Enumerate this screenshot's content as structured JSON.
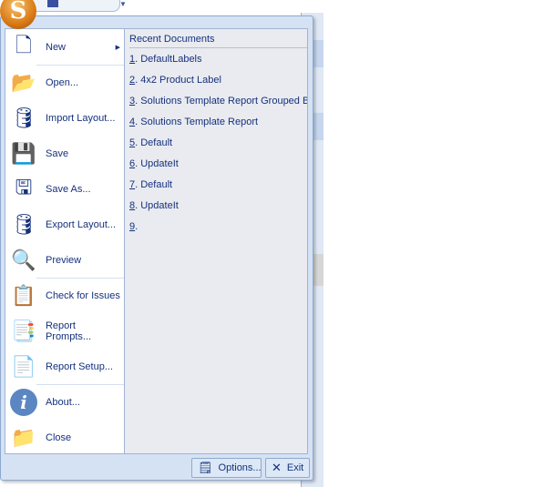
{
  "app": {
    "logo_letter": "S"
  },
  "menu": {
    "items": [
      {
        "label": "New",
        "icon": "new-document-icon",
        "submenu": true
      },
      {
        "label": "Open...",
        "icon": "open-folder-icon"
      },
      {
        "label": "Import Layout...",
        "icon": "import-database-icon"
      },
      {
        "label": "Save",
        "icon": "save-floppy-icon"
      },
      {
        "label": "Save As...",
        "icon": "save-as-icon"
      },
      {
        "label": "Export Layout...",
        "icon": "export-database-icon"
      },
      {
        "label": "Preview",
        "icon": "preview-magnifier-icon"
      },
      {
        "label": "Check for Issues",
        "icon": "check-issues-icon"
      },
      {
        "label": "Report Prompts...",
        "icon": "report-prompts-icon"
      },
      {
        "label": "Report Setup...",
        "icon": "report-setup-icon"
      },
      {
        "label": "About...",
        "icon": "info-icon"
      },
      {
        "label": "Close",
        "icon": "close-folder-icon"
      }
    ],
    "recent": {
      "title": "Recent Documents",
      "docs": [
        {
          "num": "1",
          "name": ". DefaultLabels"
        },
        {
          "num": "2",
          "name": ". 4x2 Product Label"
        },
        {
          "num": "3",
          "name": ". Solutions Template Report Grouped By"
        },
        {
          "num": "4",
          "name": ". Solutions Template Report"
        },
        {
          "num": "5",
          "name": ". Default"
        },
        {
          "num": "6",
          "name": ". UpdateIt"
        },
        {
          "num": "7",
          "name": ". Default"
        },
        {
          "num": "8",
          "name": ". UpdateIt"
        },
        {
          "num": "9",
          "name": "."
        }
      ]
    },
    "footer": {
      "options": "Options...",
      "exit": "Exit"
    }
  }
}
